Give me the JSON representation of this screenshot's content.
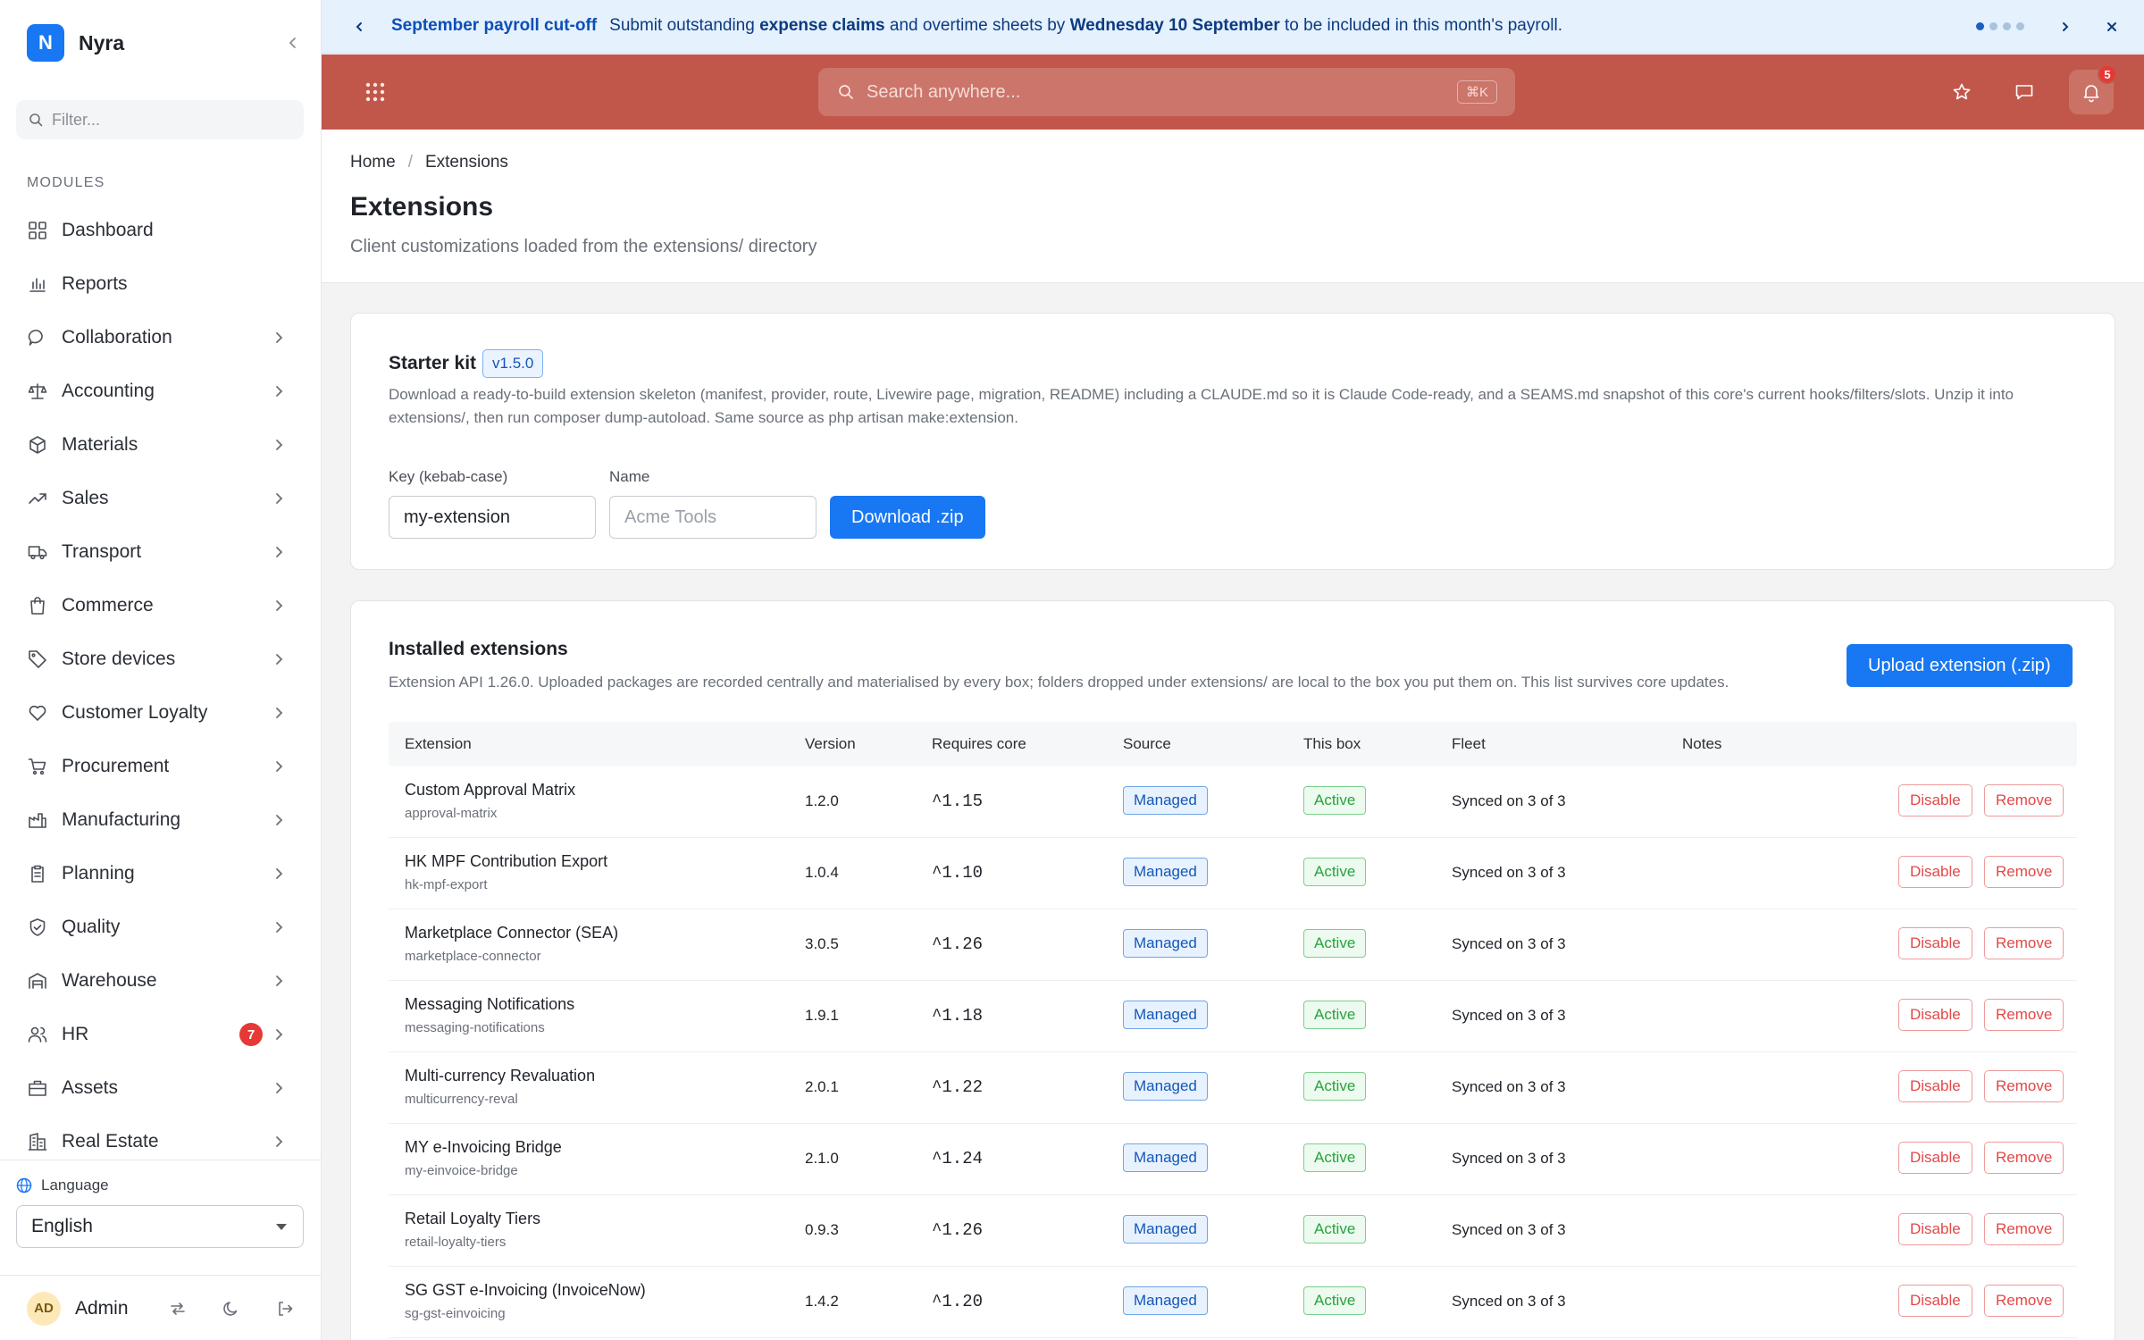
{
  "brand": {
    "initial": "N",
    "name": "Nyra"
  },
  "sidebar": {
    "filter_placeholder": "Filter...",
    "section_title": "MODULES",
    "items": [
      {
        "label": "Dashboard",
        "icon": "grid-icon",
        "chevron": false
      },
      {
        "label": "Reports",
        "icon": "bar-chart-icon",
        "chevron": false
      },
      {
        "label": "Collaboration",
        "icon": "chat-bubble-icon",
        "chevron": true
      },
      {
        "label": "Accounting",
        "icon": "scale-icon",
        "chevron": true
      },
      {
        "label": "Materials",
        "icon": "cube-icon",
        "chevron": true
      },
      {
        "label": "Sales",
        "icon": "trending-up-icon",
        "chevron": true
      },
      {
        "label": "Transport",
        "icon": "truck-icon",
        "chevron": true
      },
      {
        "label": "Commerce",
        "icon": "shopping-bag-icon",
        "chevron": true
      },
      {
        "label": "Store devices",
        "icon": "tag-icon",
        "chevron": true
      },
      {
        "label": "Customer Loyalty",
        "icon": "heart-icon",
        "chevron": true
      },
      {
        "label": "Procurement",
        "icon": "cart-icon",
        "chevron": true
      },
      {
        "label": "Manufacturing",
        "icon": "factory-icon",
        "chevron": true
      },
      {
        "label": "Planning",
        "icon": "clipboard-icon",
        "chevron": true
      },
      {
        "label": "Quality",
        "icon": "shield-check-icon",
        "chevron": true
      },
      {
        "label": "Warehouse",
        "icon": "warehouse-icon",
        "chevron": true
      },
      {
        "label": "HR",
        "icon": "users-icon",
        "chevron": true,
        "badge": "7"
      },
      {
        "label": "Assets",
        "icon": "briefcase-icon",
        "chevron": true
      },
      {
        "label": "Real Estate",
        "icon": "building-icon",
        "chevron": true
      }
    ],
    "language_label": "Language",
    "language_value": "English",
    "user": {
      "initials": "AD",
      "name": "Admin"
    }
  },
  "announcement": {
    "title": "September payroll cut-off",
    "text_1": "Submit outstanding ",
    "bold_1": "expense claims",
    "text_2": " and overtime sheets by ",
    "bold_2": "Wednesday 10 September",
    "text_3": " to be included in this month's payroll."
  },
  "topbar": {
    "search_placeholder": "Search anywhere...",
    "shortcut": "⌘K",
    "notification_count": "5",
    "accent_color": "#c1574a"
  },
  "page": {
    "breadcrumb_home": "Home",
    "breadcrumb_current": "Extensions",
    "title": "Extensions",
    "subtitle": "Client customizations loaded from the extensions/ directory"
  },
  "starter": {
    "title": "Starter kit",
    "version": "v1.5.0",
    "description": "Download a ready-to-build extension skeleton (manifest, provider, route, Livewire page, migration, README) including a CLAUDE.md so it is Claude Code-ready, and a SEAMS.md snapshot of this core's current hooks/filters/slots. Unzip it into extensions/, then run composer dump-autoload. Same source as php artisan make:extension.",
    "key_label": "Key (kebab-case)",
    "key_value": "my-extension",
    "name_label": "Name",
    "name_placeholder": "Acme Tools",
    "download_label": "Download .zip"
  },
  "installed": {
    "title": "Installed extensions",
    "description": "Extension API 1.26.0. Uploaded packages are recorded centrally and materialised by every box; folders dropped under extensions/ are local to the box you put them on. This list survives core updates.",
    "upload_label": "Upload extension (.zip)",
    "columns": {
      "extension": "Extension",
      "version": "Version",
      "requires": "Requires core",
      "source": "Source",
      "box": "This box",
      "fleet": "Fleet",
      "notes": "Notes"
    },
    "disable_label": "Disable",
    "remove_label": "Remove",
    "rows": [
      {
        "name": "Custom Approval Matrix",
        "key": "approval-matrix",
        "version": "1.2.0",
        "requires": "^1.15",
        "source": "Managed",
        "box": "Active",
        "fleet": "Synced on 3 of 3"
      },
      {
        "name": "HK MPF Contribution Export",
        "key": "hk-mpf-export",
        "version": "1.0.4",
        "requires": "^1.10",
        "source": "Managed",
        "box": "Active",
        "fleet": "Synced on 3 of 3"
      },
      {
        "name": "Marketplace Connector (SEA)",
        "key": "marketplace-connector",
        "version": "3.0.5",
        "requires": "^1.26",
        "source": "Managed",
        "box": "Active",
        "fleet": "Synced on 3 of 3"
      },
      {
        "name": "Messaging Notifications",
        "key": "messaging-notifications",
        "version": "1.9.1",
        "requires": "^1.18",
        "source": "Managed",
        "box": "Active",
        "fleet": "Synced on 3 of 3"
      },
      {
        "name": "Multi-currency Revaluation",
        "key": "multicurrency-reval",
        "version": "2.0.1",
        "requires": "^1.22",
        "source": "Managed",
        "box": "Active",
        "fleet": "Synced on 3 of 3"
      },
      {
        "name": "MY e-Invoicing Bridge",
        "key": "my-einvoice-bridge",
        "version": "2.1.0",
        "requires": "^1.24",
        "source": "Managed",
        "box": "Active",
        "fleet": "Synced on 3 of 3"
      },
      {
        "name": "Retail Loyalty Tiers",
        "key": "retail-loyalty-tiers",
        "version": "0.9.3",
        "requires": "^1.26",
        "source": "Managed",
        "box": "Active",
        "fleet": "Synced on 3 of 3"
      },
      {
        "name": "SG GST e-Invoicing (InvoiceNow)",
        "key": "sg-gst-einvoicing",
        "version": "1.4.2",
        "requires": "^1.20",
        "source": "Managed",
        "box": "Active",
        "fleet": "Synced on 3 of 3"
      }
    ]
  }
}
